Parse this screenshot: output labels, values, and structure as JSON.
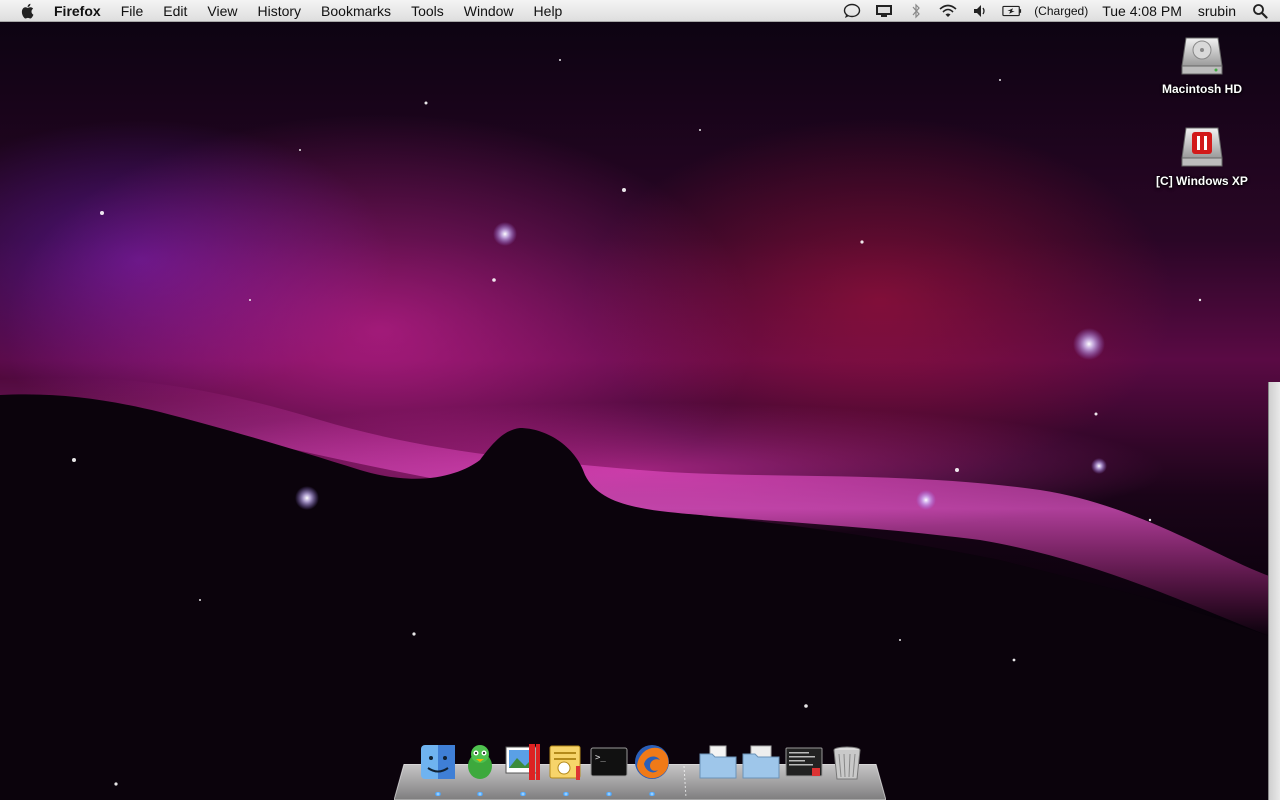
{
  "menubar": {
    "app_name": "Firefox",
    "items": [
      "File",
      "Edit",
      "View",
      "History",
      "Bookmarks",
      "Tools",
      "Window",
      "Help"
    ],
    "status": {
      "battery_text": "(Charged)",
      "clock": "Tue 4:08 PM",
      "user": "srubin"
    }
  },
  "desktop_icons": [
    {
      "label": "Macintosh HD",
      "icon": "hard-drive-icon"
    },
    {
      "label": "[C] Windows XP",
      "icon": "windows-drive-icon"
    }
  ],
  "dock": {
    "items": [
      "finder-icon",
      "adium-icon",
      "preview-icon",
      "ical-icon",
      "terminal-icon",
      "firefox-icon",
      "documents-folder-icon",
      "downloads-folder-icon",
      "console-icon",
      "trash-icon"
    ]
  },
  "colors": {
    "menubar_bg": "#e8e8e8",
    "nebula_pink": "#e628aa",
    "nebula_red": "#b4143c"
  }
}
